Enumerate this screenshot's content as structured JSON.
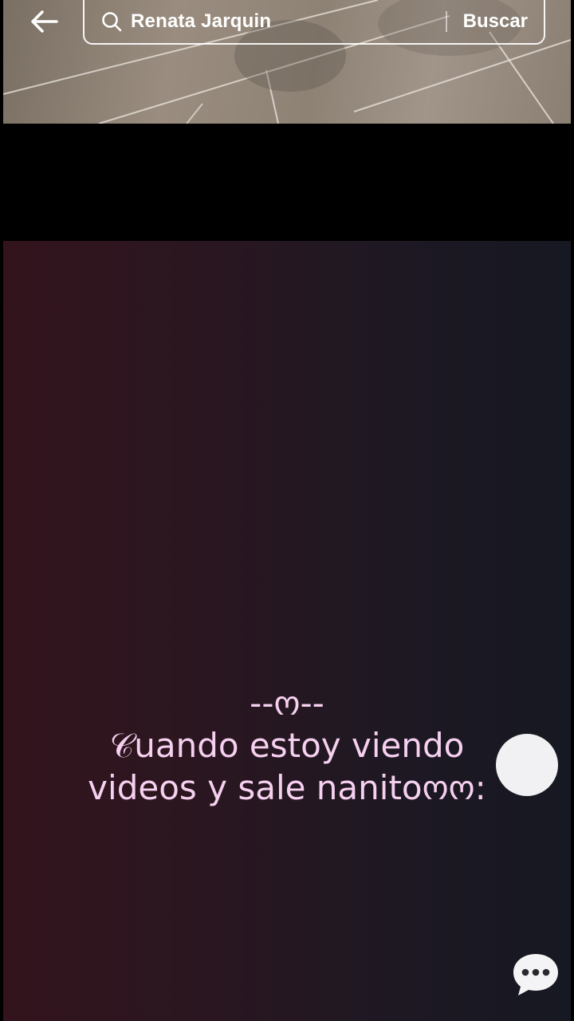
{
  "header": {
    "search_query": "Renata Jarquin",
    "search_button": "Buscar",
    "back_icon": "arrow-left-icon",
    "search_icon": "magnifier-icon"
  },
  "video": {
    "caption_line1": "--ო--",
    "caption_line2": "𝒞uando estoy viendo",
    "caption_line3": "videos y sale nanitoოო:",
    "caption_color": "#f6d0ef"
  },
  "controls": {
    "floating_button_icon": "assistive-touch-icon",
    "chat_icon": "chat-bubble-dots-icon"
  }
}
